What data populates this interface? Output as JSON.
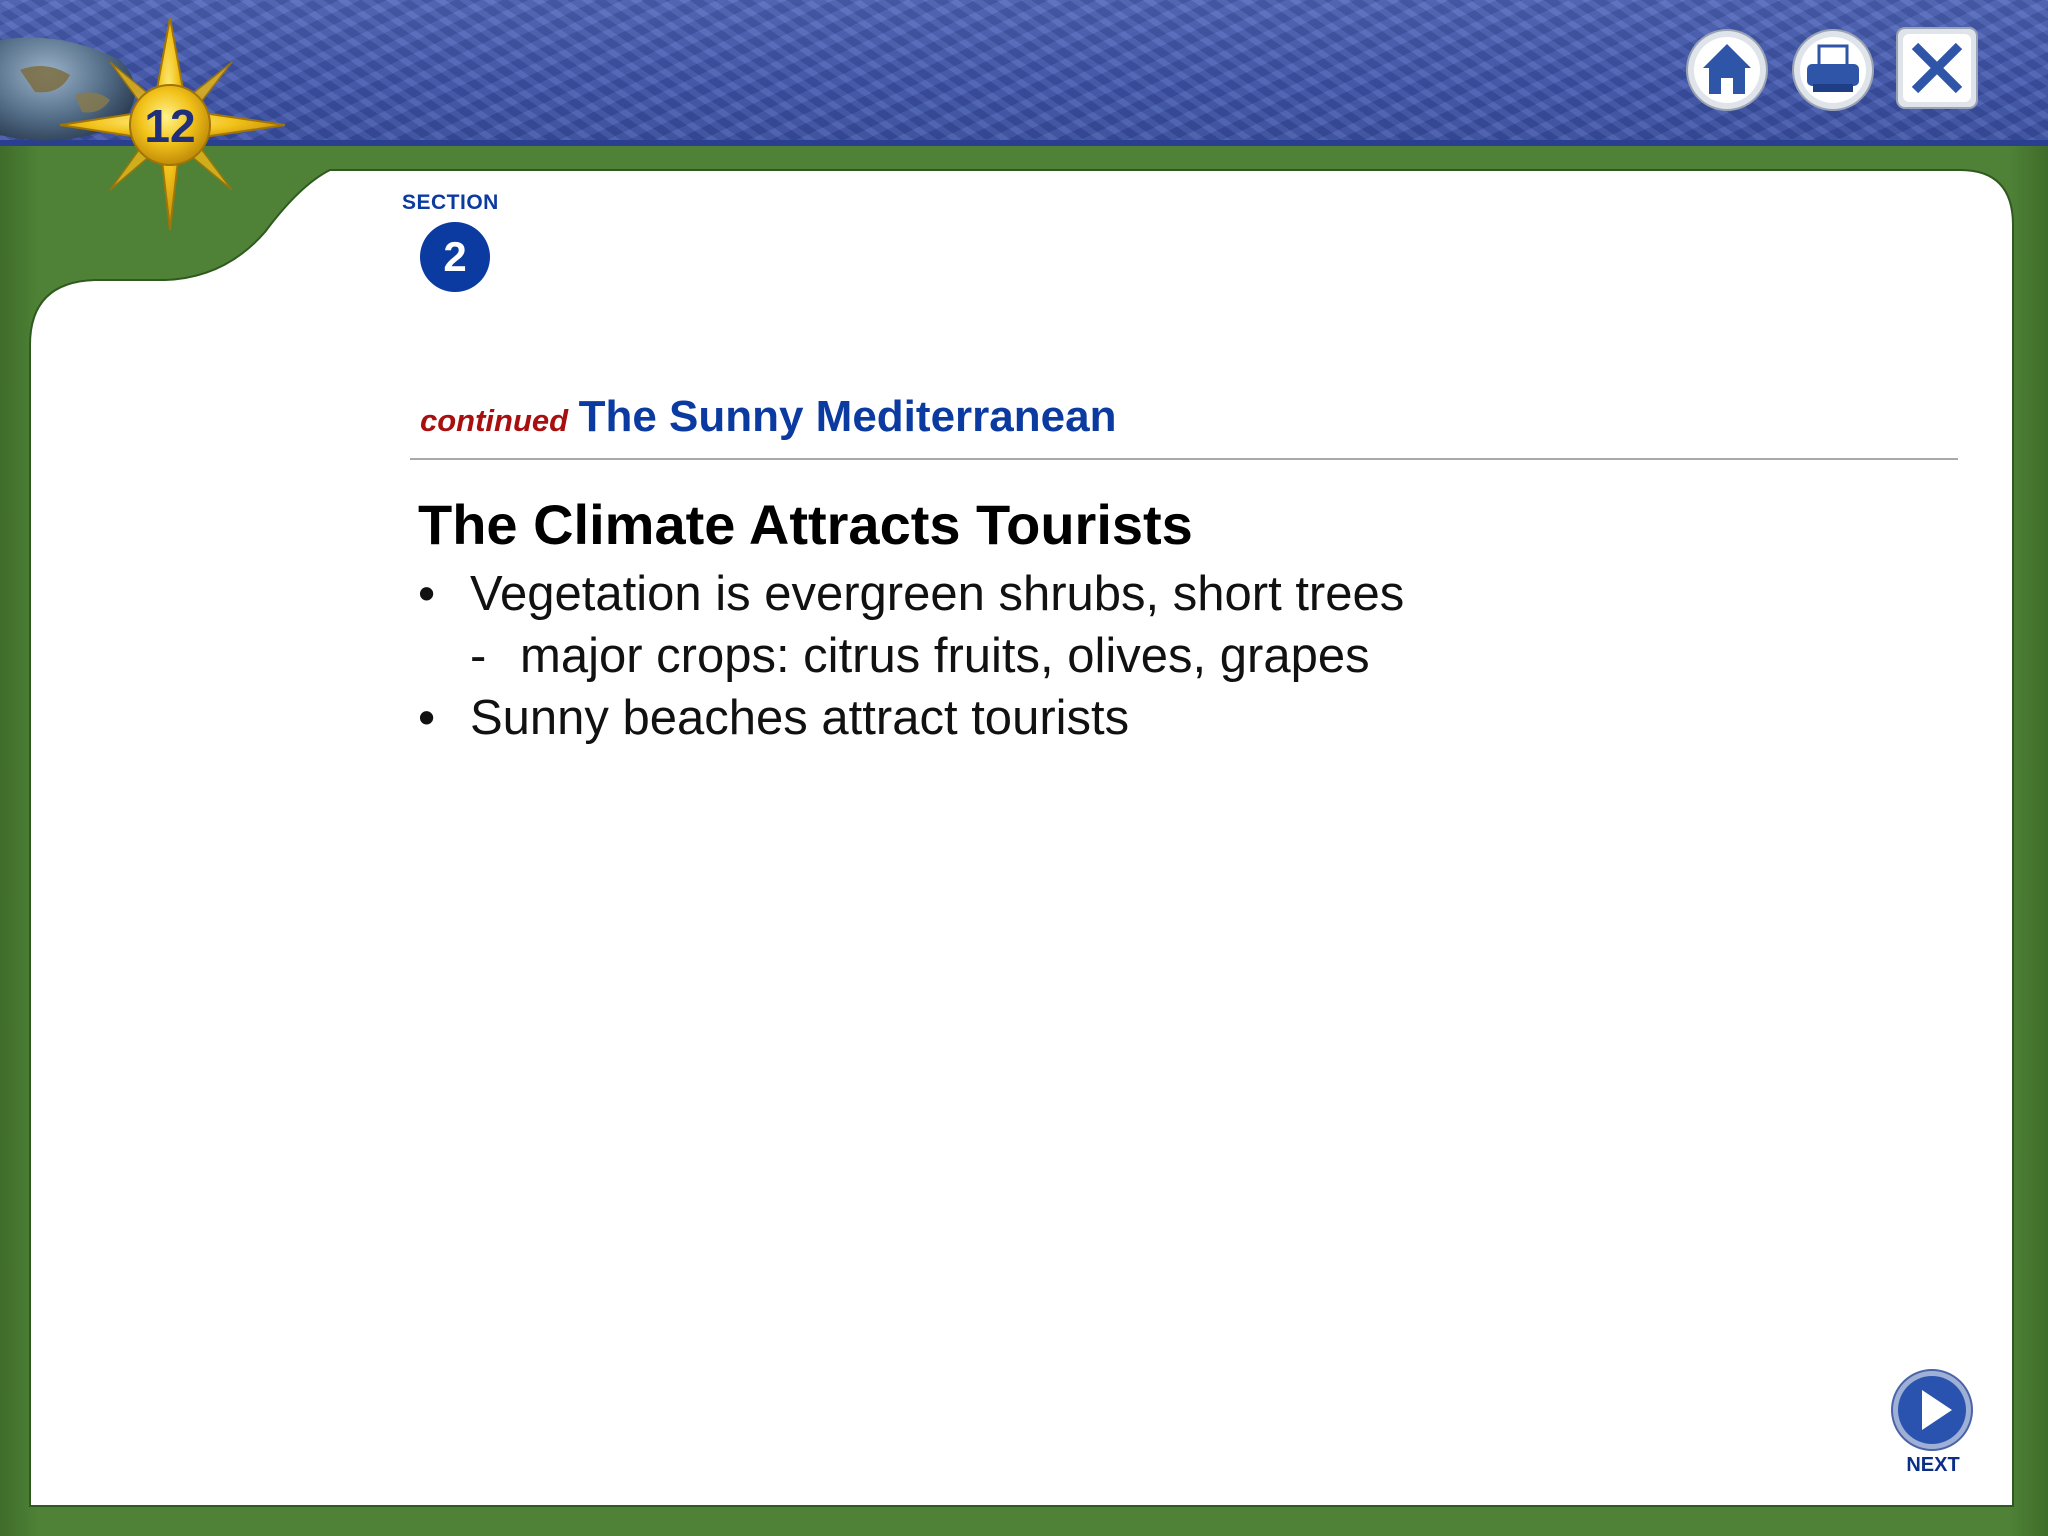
{
  "header": {
    "chapter_number": "12",
    "toolbar": {
      "home_icon": "home-icon",
      "print_icon": "printer-icon",
      "close_icon": "close-icon"
    }
  },
  "section": {
    "label": "SECTION",
    "number": "2"
  },
  "slide": {
    "continued_label": "continued",
    "heading": "The Sunny Mediterranean",
    "title": "The Climate Attracts Tourists",
    "bullets": [
      {
        "marker": "•",
        "text": "Vegetation is evergreen shrubs, short trees"
      },
      {
        "marker": "-",
        "text": "major crops: citrus fruits, olives, grapes"
      },
      {
        "marker": "•",
        "text": "Sunny beaches attract tourists"
      }
    ]
  },
  "navigation": {
    "next_label": "NEXT",
    "next_icon": "play-arrow-icon"
  },
  "colors": {
    "header_blue": "#3e55ad",
    "frame_green": "#4f8237",
    "accent_blue": "#0b3aa0",
    "continued_red": "#a80f0f",
    "star_gold": "#f2c21a"
  }
}
